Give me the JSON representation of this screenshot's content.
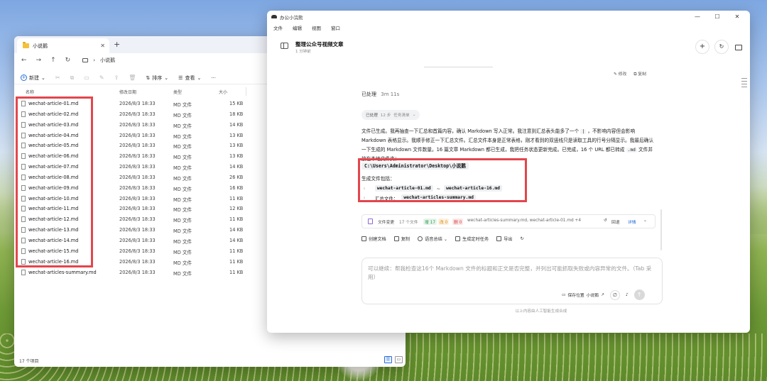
{
  "explorer": {
    "tab_title": "小说鹅",
    "tab_close": "✕",
    "new_tab": "+",
    "nav": {
      "back": "←",
      "forward": "→",
      "up": "↑",
      "refresh": "↻",
      "sep": "›",
      "current_folder": "小说鹅"
    },
    "toolbar": {
      "new_label": "新建",
      "sort_label": "排序",
      "view_label": "查看",
      "more_label": "···",
      "cut_icon": "✂",
      "copy_icon": "⧉",
      "paste_icon": "▭",
      "rename_icon": "✎",
      "share_icon": "⇪",
      "delete_icon": "🗑"
    },
    "columns": {
      "name": "名称",
      "date": "修改日期",
      "type": "类型",
      "size": "大小"
    },
    "files": [
      {
        "name": "wechat-article-01.md",
        "date": "2026/8/3 18:33",
        "type": "MD 文件",
        "size": "15 KB"
      },
      {
        "name": "wechat-article-02.md",
        "date": "2026/8/3 18:33",
        "type": "MD 文件",
        "size": "18 KB"
      },
      {
        "name": "wechat-article-03.md",
        "date": "2026/8/3 18:33",
        "type": "MD 文件",
        "size": "14 KB"
      },
      {
        "name": "wechat-article-04.md",
        "date": "2026/8/3 18:33",
        "type": "MD 文件",
        "size": "13 KB"
      },
      {
        "name": "wechat-article-05.md",
        "date": "2026/8/3 18:33",
        "type": "MD 文件",
        "size": "13 KB"
      },
      {
        "name": "wechat-article-06.md",
        "date": "2026/8/3 18:33",
        "type": "MD 文件",
        "size": "13 KB"
      },
      {
        "name": "wechat-article-07.md",
        "date": "2026/8/3 18:33",
        "type": "MD 文件",
        "size": "14 KB"
      },
      {
        "name": "wechat-article-08.md",
        "date": "2026/8/3 18:33",
        "type": "MD 文件",
        "size": "26 KB"
      },
      {
        "name": "wechat-article-09.md",
        "date": "2026/8/3 18:33",
        "type": "MD 文件",
        "size": "16 KB"
      },
      {
        "name": "wechat-article-10.md",
        "date": "2026/8/3 18:33",
        "type": "MD 文件",
        "size": "11 KB"
      },
      {
        "name": "wechat-article-11.md",
        "date": "2026/8/3 18:33",
        "type": "MD 文件",
        "size": "12 KB"
      },
      {
        "name": "wechat-article-12.md",
        "date": "2026/8/3 18:33",
        "type": "MD 文件",
        "size": "11 KB"
      },
      {
        "name": "wechat-article-13.md",
        "date": "2026/8/3 18:33",
        "type": "MD 文件",
        "size": "14 KB"
      },
      {
        "name": "wechat-article-14.md",
        "date": "2026/8/3 18:33",
        "type": "MD 文件",
        "size": "14 KB"
      },
      {
        "name": "wechat-article-15.md",
        "date": "2026/8/3 18:33",
        "type": "MD 文件",
        "size": "11 KB"
      },
      {
        "name": "wechat-article-16.md",
        "date": "2026/8/3 18:33",
        "type": "MD 文件",
        "size": "11 KB"
      },
      {
        "name": "wechat-articles-summary.md",
        "date": "2026/8/3 18:33",
        "type": "MD 文件",
        "size": "11 KB"
      }
    ],
    "status": "17 个项目",
    "view_details_icon": "☰",
    "view_tiles_icon": "▭"
  },
  "ai": {
    "app_title": "办公小浣熊",
    "win_min": "—",
    "win_max": "☐",
    "win_close": "✕",
    "menu": [
      "文件",
      "编辑",
      "视图",
      "窗口"
    ],
    "conversation_title": "整理公众号视频文章",
    "conversation_time": "1 分钟前",
    "header_plus": "+",
    "header_refresh": "↻",
    "msg_actions": {
      "edit": "✎ 修改",
      "copy": "⧉ 复制"
    },
    "processed_label": "已处理",
    "processed_duration": "3m 11s",
    "chip": {
      "label": "已处理",
      "steps": "12 步",
      "sub": "任务清单",
      "caret": "⌄"
    },
    "body_text_a": "文件已生成。我再抽查一下汇总和首篇内容，确认 Markdown 写入正常。我注意到汇总表头能多了一个",
    "body_text_b": "，不影响内容但会影响 Markdown 表格显示。我顺手修正一下汇总文件。汇总文件本身是正常表格，刚才看到的双竖线只是读取工具的行号分隔显示。我最后确认一下生成的 Markdown 文件数量。16 篇文章 Markdown 都已生成，我把任务状态更新完成。已完成，16 个 URL 都已转成",
    "body_text_c": "文件并放在本地文件夹：",
    "pipe_symbol": "|",
    "md_ext": ".md",
    "path": "C:\\Users\\Administrator\\Desktop\\小说鹅",
    "files_label": "生成文件包括：",
    "bullet_dot": "◦",
    "bullet1_from": "wechat-article-01.md",
    "tilde": "~",
    "bullet1_to": "wechat-article-16.md",
    "bullet2_label": "汇总文件：",
    "bullet2_file": "wechat-articles-summary.md",
    "change_card": {
      "title": "文件变更",
      "count": "17 个文件",
      "added": "增 17",
      "modified": "改 0",
      "deleted": "删 0",
      "file_list": "wechat-articles-summary.md, wechat-article-01.md +4",
      "undo": "回退",
      "detail": "详情",
      "caret": "⌄"
    },
    "actions": [
      "创建文档",
      "复制",
      "语音总结 ⌄",
      "生成定时任务",
      "导出"
    ],
    "action_refresh": "↻",
    "input_placeholder": "可以继续：帮我检查这16个 Markdown 文件的标题和正文是否完整，并列出可能抓取失败或内容异常的文件。（Tab 采用）",
    "save_location": "保存位置",
    "save_folder": "小说鹅",
    "open_icon": "↗",
    "attach_icon": "∅",
    "mic_icon": "♪",
    "send_icon": "↑",
    "disclaimer": "以上内容由人工智能生成合成"
  },
  "colors": {
    "highlight": "#e3464c",
    "accent": "#2a6fd6"
  }
}
